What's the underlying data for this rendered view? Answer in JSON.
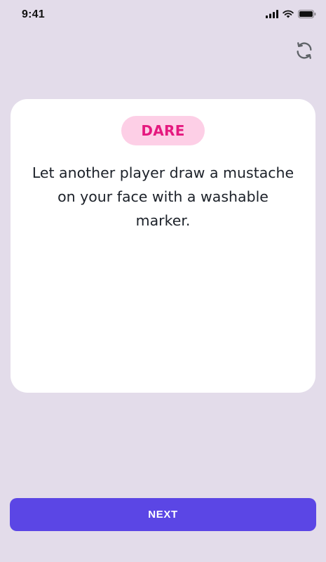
{
  "status_bar": {
    "time": "9:41",
    "icons": [
      "cellular-signal-icon",
      "wifi-icon",
      "battery-icon"
    ]
  },
  "toolbar": {
    "refresh_icon": "refresh-icon"
  },
  "card": {
    "badge_label": "DARE",
    "prompt_text": "Let another player draw a mustache on your face with a washable marker."
  },
  "next_button": {
    "label": "NEXT"
  },
  "colors": {
    "background": "#e3dcea",
    "card": "#ffffff",
    "badge_bg": "#fdcfe6",
    "badge_text": "#e5197f",
    "primary": "#5b46e5"
  }
}
